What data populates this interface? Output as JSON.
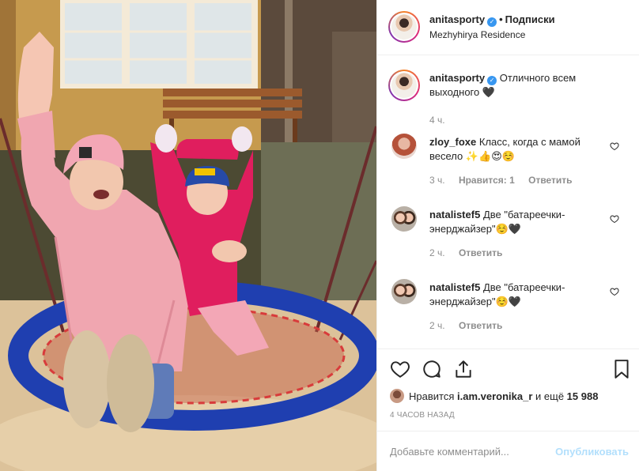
{
  "post": {
    "username": "anitasporty",
    "follow_label": "Подписки",
    "location": "Mezhyhirya Residence",
    "caption_user": "anitasporty",
    "caption_text": "Отличного всем выходного 🖤",
    "caption_time": "4 ч."
  },
  "comments": [
    {
      "user": "zloy_foxe",
      "text": "Класс, когда с мамой весело ✨👍😍☺️",
      "time": "3 ч.",
      "likes": "Нравится: 1",
      "reply": "Ответить"
    },
    {
      "user": "natalistef5",
      "text": "Две \"батареечки-энерджайзер\"☺️🖤",
      "time": "2 ч.",
      "reply": "Ответить"
    },
    {
      "user": "natalistef5",
      "text": "Две \"батареечки-энерджайзер\"☺️🖤",
      "time": "2 ч.",
      "reply": "Ответить"
    }
  ],
  "likes": {
    "prefix": "Нравится",
    "user": "i.am.veronika_r",
    "suffix": "и ещё",
    "count": "15 988"
  },
  "timestamp": "4 ЧАСОВ НАЗАД",
  "add_comment": {
    "placeholder": "Добавьте комментарий...",
    "post_label": "Опубликовать"
  },
  "icons": [
    "verified-icon",
    "heart-icon",
    "comment-icon",
    "share-icon",
    "bookmark-icon"
  ],
  "colors": {
    "accent": "#3897f0",
    "muted": "#8e8e8e",
    "post_disabled": "#b2dffc",
    "text": "#262626"
  }
}
